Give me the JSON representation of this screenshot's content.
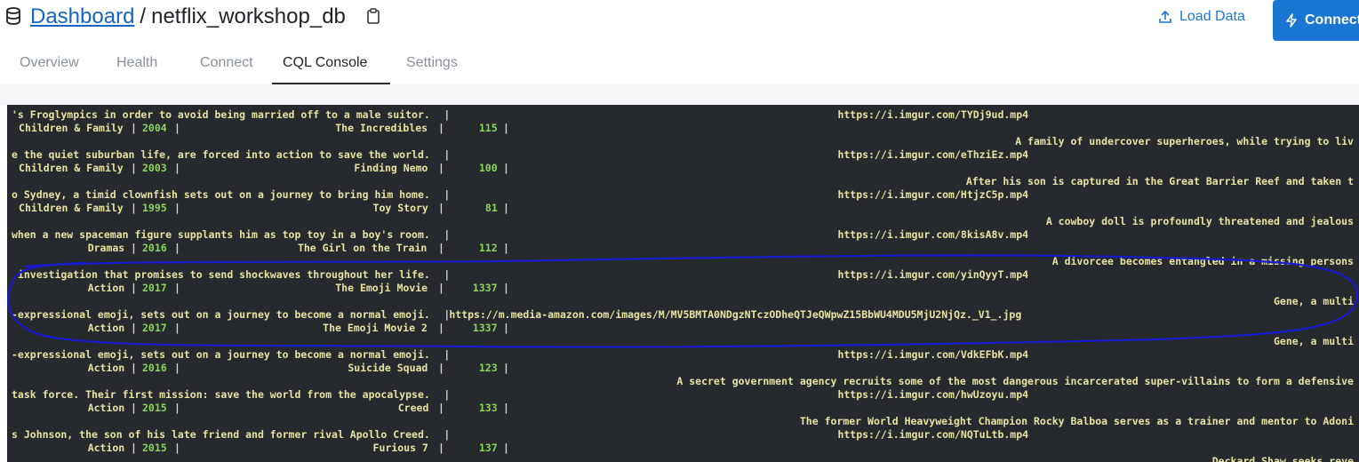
{
  "header": {
    "breadcrumb_root": "Dashboard",
    "separator": "/",
    "db_name": "netflix_workshop_db",
    "load_data_label": "Load Data",
    "connect_label": "Connect"
  },
  "tabs": [
    {
      "label": "Overview"
    },
    {
      "label": "Health"
    },
    {
      "label": "Connect"
    },
    {
      "label": "CQL Console"
    },
    {
      "label": "Settings"
    }
  ],
  "console": {
    "lines": [
      {
        "a": "'s Froglympics in order to avoid being married off to a male suitor.",
        "url": "https://i.imgur.com/TYDj9ud.mp4"
      },
      {
        "genre": " Children & Family",
        "year": "2004",
        "title": "The Incredibles",
        "dur": "115"
      },
      {
        "r": "A family of undercover superheroes, while trying to liv"
      },
      {
        "a": "e the quiet suburban life, are forced into action to save the world.",
        "url": "https://i.imgur.com/eThziEz.mp4"
      },
      {
        "genre": " Children & Family",
        "year": "2003",
        "title": "Finding Nemo",
        "dur": "100"
      },
      {
        "r": "After his son is captured in the Great Barrier Reef and taken t"
      },
      {
        "a": "o Sydney, a timid clownfish sets out on a journey to bring him home.",
        "url": "https://i.imgur.com/HtjzC5p.mp4"
      },
      {
        "genre": " Children & Family",
        "year": "1995",
        "title": "Toy Story",
        "dur": "81"
      },
      {
        "r": "A cowboy doll is profoundly threatened and jealous"
      },
      {
        "a": "when a new spaceman figure supplants him as top toy in a boy's room.",
        "url": "https://i.imgur.com/8kisA8v.mp4"
      },
      {
        "genre": "Dramas",
        "year": "2016",
        "title": "The Girl on the Train",
        "dur": "112"
      },
      {
        "r": "A divorcee becomes entangled in a missing persons"
      },
      {
        "a": " investigation that promises to send shockwaves throughout her life.",
        "url": "https://i.imgur.com/yinQyyT.mp4"
      },
      {
        "genre": "Action",
        "year": "2017",
        "title": "The Emoji Movie",
        "dur": "1337"
      },
      {
        "r": "Gene, a multi"
      },
      {
        "a": "-expressional emoji, sets out on a journey to become a normal emoji.",
        "url": "https://m.media-amazon.com/images/M/MV5BMTA0NDgzNTczODheQTJeQWpwZ15BbWU4MDU5MjU2NjQz._V1_.jpg"
      },
      {
        "genre": "Action",
        "year": "2017",
        "title": "The Emoji Movie 2",
        "dur": "1337"
      },
      {
        "r": "Gene, a multi"
      },
      {
        "a": "-expressional emoji, sets out on a journey to become a normal emoji.",
        "url": "https://i.imgur.com/VdkEFbK.mp4"
      },
      {
        "genre": "Action",
        "year": "2016",
        "title": "Suicide Squad",
        "dur": "123"
      },
      {
        "r": "A secret government agency recruits some of the most dangerous incarcerated super-villains to form a defensive"
      },
      {
        "a": "task force. Their first mission: save the world from the apocalypse.",
        "url": "https://i.imgur.com/hwUzoyu.mp4"
      },
      {
        "genre": "Action",
        "year": "2015",
        "title": "Creed",
        "dur": "133"
      },
      {
        "r": "The former World Heavyweight Champion Rocky Balboa serves as a trainer and mentor to Adoni"
      },
      {
        "a": "s Johnson, the son of his late friend and former rival Apollo Creed.",
        "url": "https://i.imgur.com/NQTuLtb.mp4"
      },
      {
        "genre": "Action",
        "year": "2015",
        "title": "Furious 7",
        "dur": "137"
      },
      {
        "r": "Deckard Shaw seeks reve"
      }
    ]
  },
  "colors": {
    "accent": "#1976d2",
    "console_bg": "#262a2e",
    "console_text": "#e8e3a3",
    "console_number": "#8bd55a",
    "annotation": "#1a1ad0"
  }
}
